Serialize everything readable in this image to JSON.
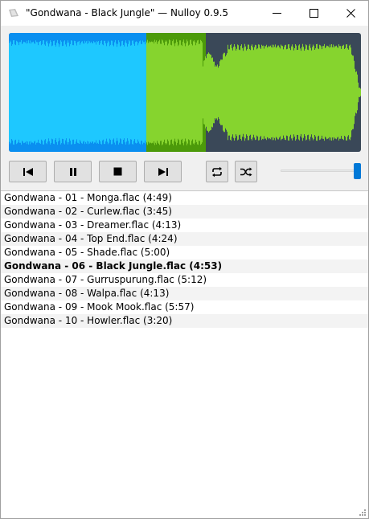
{
  "window": {
    "title": "\"Gondwana - Black Jungle\" — Nulloy 0.9.5",
    "buttons": [
      "minimize-icon",
      "maximize-icon",
      "close-icon"
    ]
  },
  "colors": {
    "wave_bg": "#3a4858",
    "played_background": "#0a8ff0",
    "played_wave": "#1ec8ff",
    "unplayed_background": "#4c9a0a",
    "unplayed_wave": "#86d42e",
    "accent": "#0078d7"
  },
  "waveform": {
    "progress": 0.39
  },
  "controls": {
    "icons": [
      "skip-previous-icon",
      "pause-icon",
      "stop-icon",
      "skip-next-icon",
      "repeat-icon",
      "shuffle-icon"
    ],
    "volume": 1.0
  },
  "playlist": {
    "items": [
      {
        "label": "Gondwana - 01 - Monga.flac (4:49)",
        "current": false
      },
      {
        "label": "Gondwana - 02 - Curlew.flac (3:45)",
        "current": false
      },
      {
        "label": "Gondwana - 03 - Dreamer.flac (4:13)",
        "current": false
      },
      {
        "label": "Gondwana - 04 - Top End.flac (4:24)",
        "current": false
      },
      {
        "label": "Gondwana - 05 - Shade.flac (5:00)",
        "current": false
      },
      {
        "label": "Gondwana - 06 - Black Jungle.flac (4:53)",
        "current": true
      },
      {
        "label": "Gondwana - 07 - Gurruspurung.flac (5:12)",
        "current": false
      },
      {
        "label": "Gondwana - 08 - Walpa.flac (4:13)",
        "current": false
      },
      {
        "label": "Gondwana - 09 - Mook Mook.flac (5:57)",
        "current": false
      },
      {
        "label": "Gondwana - 10 - Howler.flac (3:20)",
        "current": false
      }
    ]
  }
}
